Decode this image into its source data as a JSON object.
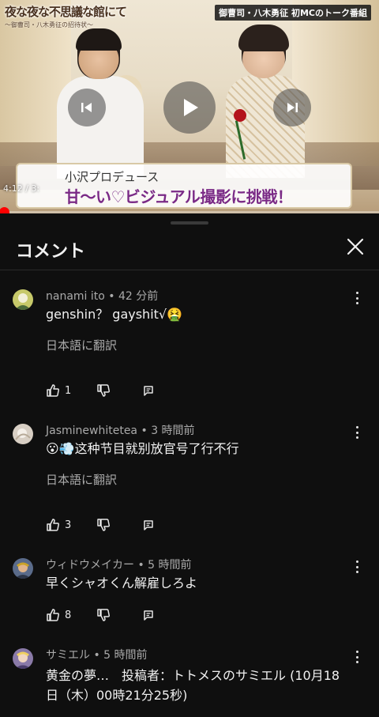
{
  "video": {
    "logo_title": "夜な夜な不思議な館にて",
    "logo_subtitle": "〜御曹司・八木勇征の招待状〜",
    "broadcast_tag": "御曹司・八木勇征 初MCのトーク番組",
    "caption_line1": "小沢プロデュース",
    "caption_line2": "甘〜い♡ビジュアル撮影に挑戦！",
    "time_display": "4:12 / 3:",
    "progress_fraction": 0.01
  },
  "panel": {
    "title": "コメント"
  },
  "comments": [
    {
      "author": "nanami ito",
      "time": "42 分前",
      "text": "genshin？ gayshit√🤮",
      "translate": "日本語に翻訳",
      "likes": "1",
      "avatar_color": "#c7c96a"
    },
    {
      "author": "Jasminewhitetea",
      "time": "3 時間前",
      "text": "😮💨这种节目就别放官号了行不行",
      "translate": "日本語に翻訳",
      "likes": "3",
      "avatar_color": "#d8cfc4"
    },
    {
      "author": "ウィドウメイカー",
      "time": "5 時間前",
      "text": "早くシャオくん解雇しろよ",
      "translate": "",
      "likes": "8",
      "avatar_color": "#5a6b8a"
    },
    {
      "author": "サミエル",
      "time": "5 時間前",
      "text": "黄金の夢…　投稿者：トトメスのサミエル (10月18日（木）00時21分25秒)",
      "translate": "",
      "likes": "",
      "avatar_color": "#8a7aa8"
    }
  ]
}
